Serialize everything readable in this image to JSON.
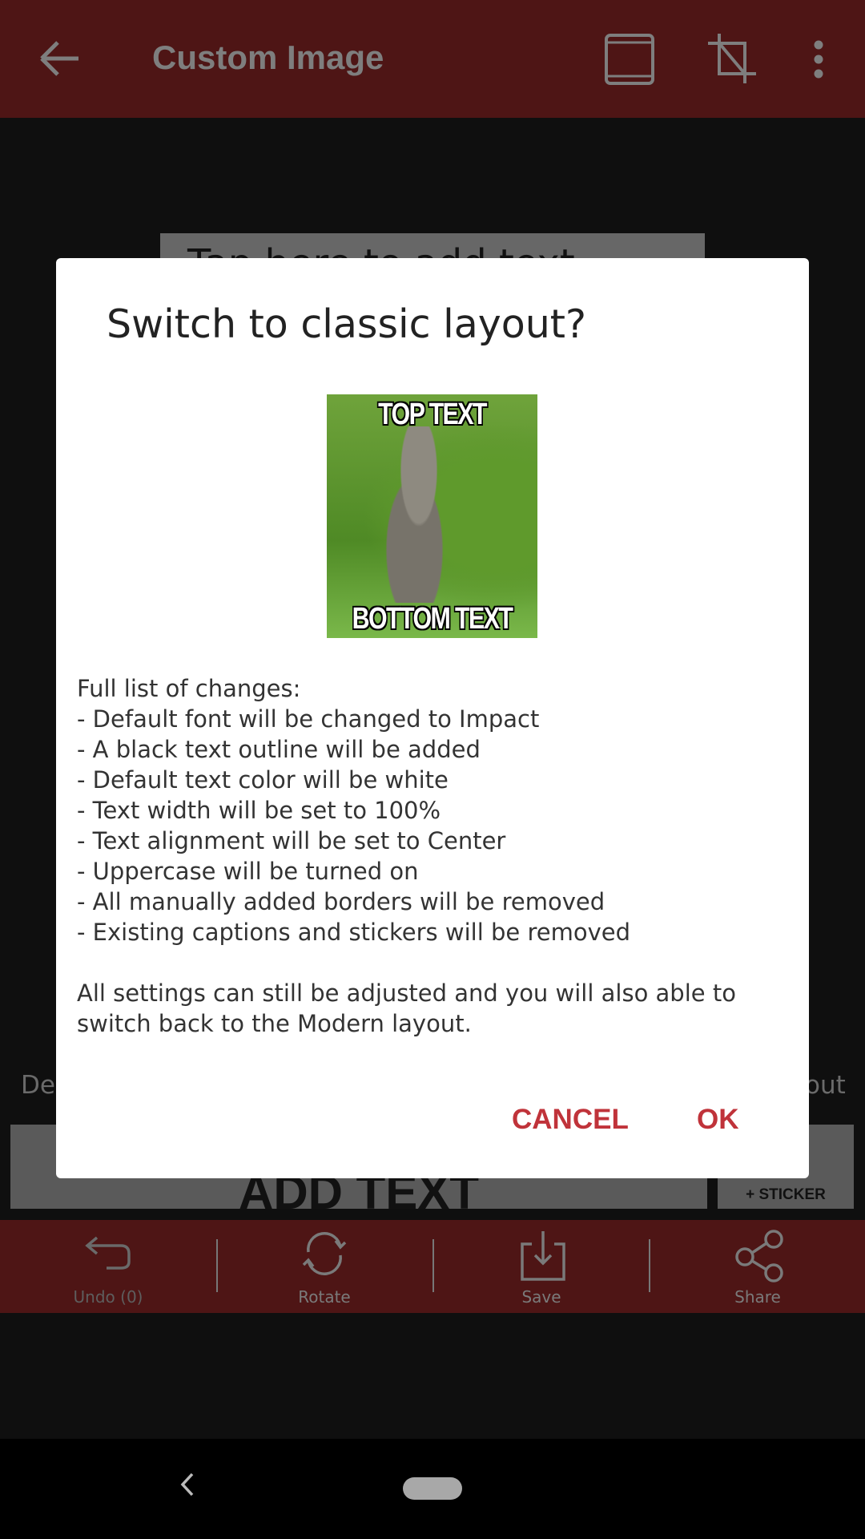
{
  "app_bar": {
    "title": "Custom Image",
    "icons": [
      "arrow-back-icon",
      "layout-frame-icon",
      "crop-off-icon",
      "more-vert-icon"
    ]
  },
  "background": {
    "tap_text": "Tap here to add text",
    "left_text": "De",
    "right_text": "out",
    "add_text": "ADD TEXT",
    "sticker_label": "+ STICKER"
  },
  "bottom_bar": {
    "items": [
      {
        "label": "Undo (0)",
        "icon": "undo-icon"
      },
      {
        "label": "Rotate",
        "icon": "rotate-icon"
      },
      {
        "label": "Save",
        "icon": "save-icon"
      },
      {
        "label": "Share",
        "icon": "share-icon"
      }
    ]
  },
  "dialog": {
    "title": "Switch to classic layout?",
    "meme": {
      "top_text": "TOP TEXT",
      "bottom_text": "BOTTOM TEXT"
    },
    "changes_header": "Full list of changes:",
    "changes": [
      "- Default font will be changed to Impact",
      "- A black text outline will be added",
      "- Default text color will be white",
      "- Text width will be set to 100%",
      "- Text alignment will be set to Center",
      "- Uppercase will be turned on",
      "- All manually added borders will be removed",
      "- Existing captions and stickers will be removed"
    ],
    "note": "All settings can still be adjusted and you will also able to switch back to the Modern layout.",
    "cancel": "CANCEL",
    "ok": "OK"
  },
  "colors": {
    "accent": "#c0333a",
    "app_bar": "#4e1515"
  }
}
